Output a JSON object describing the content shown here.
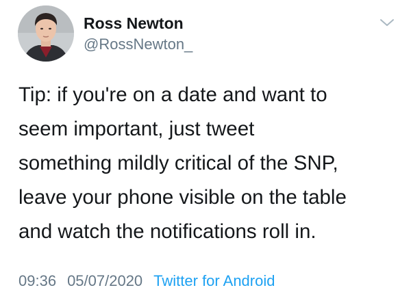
{
  "author": {
    "display_name": "Ross Newton",
    "handle": "@RossNewton_"
  },
  "tweet": {
    "lines": [
      "Tip: if you're on a date and want to",
      "seem important, just tweet",
      "something mildly critical of the SNP,",
      "leave your phone visible on the table",
      "and watch the notifications roll in."
    ]
  },
  "meta": {
    "time": "09:36",
    "date": "05/07/2020",
    "source": "Twitter for Android"
  },
  "icons": {
    "menu": "chevron-down-icon",
    "avatar": "profile-photo"
  },
  "colors": {
    "text": "#14171a",
    "secondary": "#657786",
    "link": "#1da1f2",
    "chevron": "#aab8c2"
  }
}
